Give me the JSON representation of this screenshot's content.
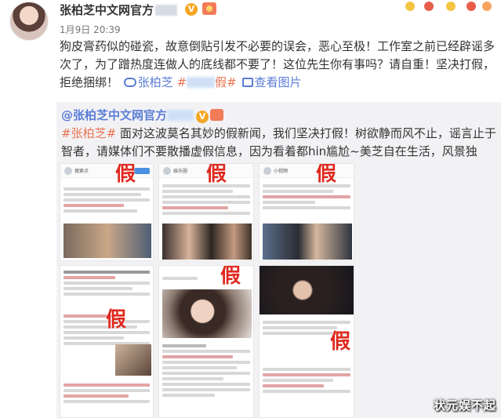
{
  "post": {
    "username": "张柏芝中文网官方",
    "verified_badge": "V",
    "time": "1月9日 20:39",
    "text_segments": {
      "p1": "狗皮膏药似的碰瓷，故意倒贴引发不必要的误会，恶心至极！工作室之前已经辟谣多次了，为了蹭热度连做人的底线都不要了！这位先生你有事吗？请自重！坚决打假，拒绝捆绑！",
      "link_label": "张柏芝",
      "tag": "#",
      "tag_end": "假#",
      "view_pics": "查看图片"
    }
  },
  "repost": {
    "author": "@张柏芝中文网官方",
    "verified_badge": "V",
    "tag": "#张柏芝#",
    "text": " 面对这波莫名其妙的假新闻，我们坚决打假！树欲静而风不止，谣言止于智者，请媒体们不要散播虚假信息，因为看着都hin尴尬~美芝自在生活，风景独好，给大家比心"
  },
  "screenshots": {
    "fake_label": "假",
    "labels": {
      "s1_name": "搜索点",
      "s2_name": "娱乐圈",
      "s3_name": "小视频"
    }
  },
  "watermark": "状元娱不起",
  "colors": {
    "accent_orange": "#eb7350",
    "link_blue": "#5b7dd6",
    "fake_red": "#e0281e",
    "repost_bg": "#f2f2f5"
  }
}
